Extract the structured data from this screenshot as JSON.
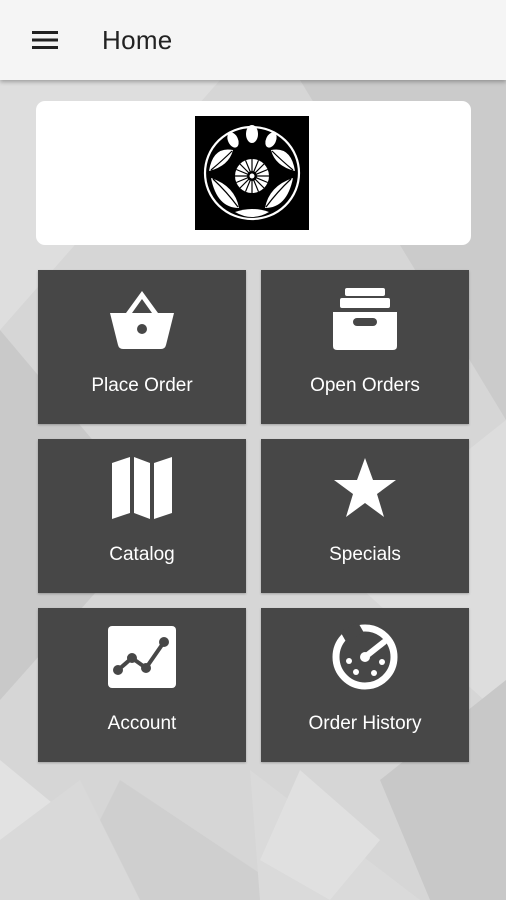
{
  "app_bar": {
    "title": "Home",
    "menu_icon": "hamburger-menu-icon"
  },
  "logo": {
    "icon": "crest-logo"
  },
  "tiles": [
    {
      "label": "Place Order",
      "icon": "basket-icon"
    },
    {
      "label": "Open Orders",
      "icon": "inbox-tray-icon"
    },
    {
      "label": "Catalog",
      "icon": "map-icon"
    },
    {
      "label": "Specials",
      "icon": "star-icon"
    },
    {
      "label": "Account",
      "icon": "line-chart-icon"
    },
    {
      "label": "Order History",
      "icon": "history-dial-icon"
    }
  ],
  "colors": {
    "tile_background": "#474747",
    "app_bar_background": "#f5f5f5",
    "page_background": "#d4d4d4"
  }
}
